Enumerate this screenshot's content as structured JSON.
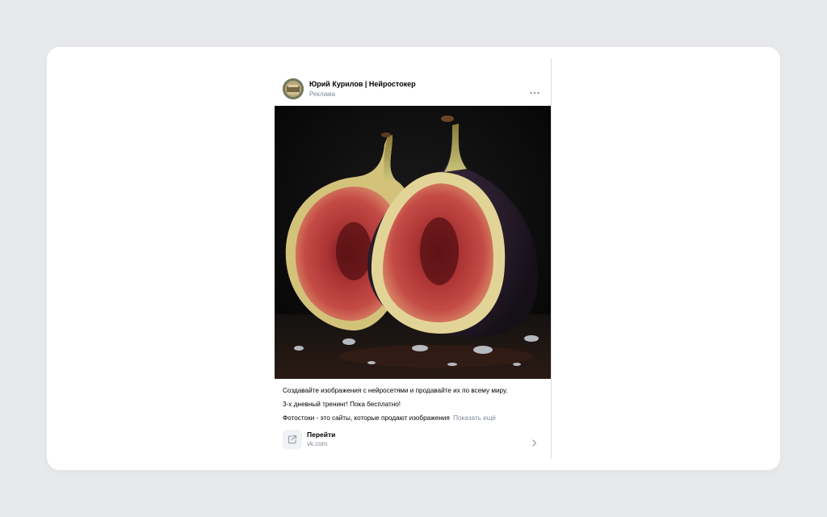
{
  "post": {
    "author": "Юрий Курилов | Нейростокер",
    "label": "Реклама",
    "text_lines": [
      "Создавайте изображения с нейросетями и продавайте их по всему миру.",
      "3-х дневный тренинг! Пока бесплатно!",
      "Фотостоки - это сайты, которые продают изображения"
    ],
    "show_more": "Показать ещё"
  },
  "link": {
    "title": "Перейти",
    "domain": "vk.com"
  },
  "icons": {
    "more": "more-horizontal-icon",
    "external_link": "external-link-icon",
    "chevron": "chevron-right-icon"
  },
  "colors": {
    "background": "#e8e9eb",
    "card": "#ffffff",
    "secondary_text": "#818c99",
    "fig_flesh": "#b83a3a",
    "fig_skin": "#2a1f2e"
  }
}
